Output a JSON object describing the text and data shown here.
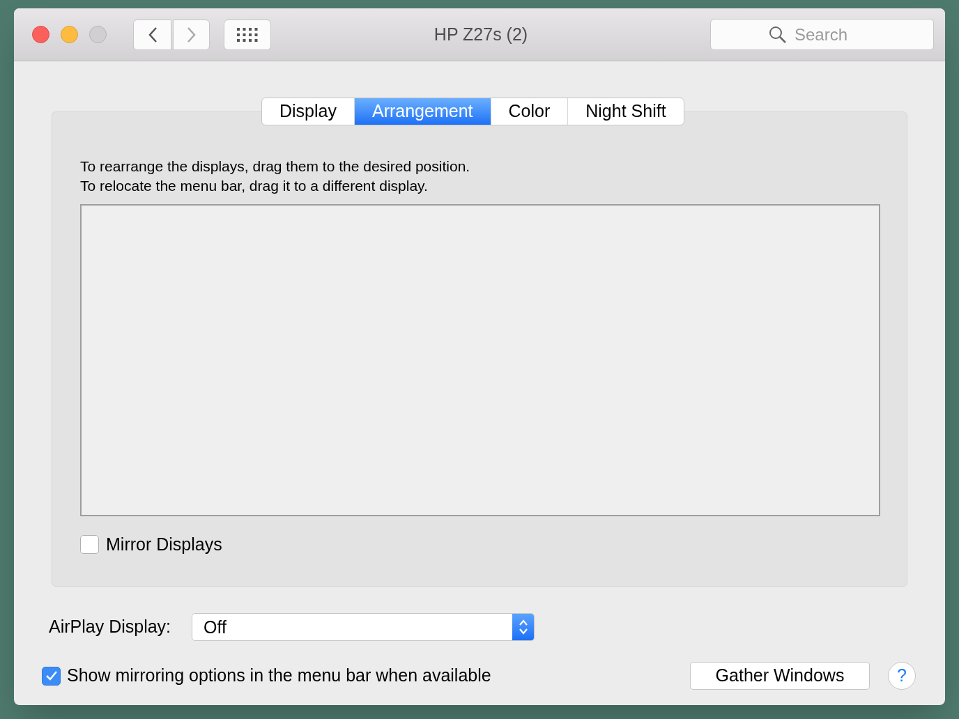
{
  "window": {
    "title": "HP Z27s (2)"
  },
  "toolbar": {
    "search": {
      "placeholder": "Search"
    }
  },
  "tabs": [
    {
      "label": "Display",
      "selected": false
    },
    {
      "label": "Arrangement",
      "selected": true
    },
    {
      "label": "Color",
      "selected": false
    },
    {
      "label": "Night Shift",
      "selected": false
    }
  ],
  "instructions": [
    "To rearrange the displays, drag them to the desired position.",
    "To relocate the menu bar, drag it to a different display."
  ],
  "mirror_displays": {
    "label": "Mirror Displays",
    "checked": false
  },
  "airplay": {
    "label": "AirPlay Display:",
    "value": "Off"
  },
  "show_mirroring": {
    "label": "Show mirroring options in the menu bar when available",
    "checked": true
  },
  "gather_button": "Gather Windows",
  "help_button": "?"
}
